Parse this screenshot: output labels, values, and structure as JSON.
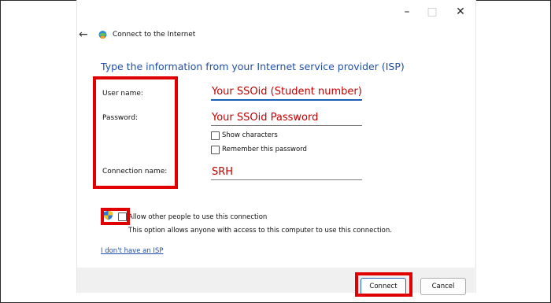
{
  "window": {
    "minimize_glyph": "–",
    "maximize_glyph": "□",
    "close_glyph": "✕",
    "back_glyph": "←",
    "title": "Connect to the Internet"
  },
  "form": {
    "heading": "Type the information from your Internet service provider (ISP)",
    "username_label": "User name:",
    "username_value": "Your SSOid (Student number)",
    "password_label": "Password:",
    "password_value": "Your SSOid Password",
    "show_characters_label": "Show characters",
    "remember_password_label": "Remember this password",
    "connection_name_label": "Connection name:",
    "connection_name_value": "SRH",
    "allow_others_label": "Allow other people to use this connection",
    "allow_others_note": "This option allows anyone with access to this computer to use this connection.",
    "no_isp_link": "I don't have an ISP"
  },
  "footer": {
    "connect_label": "Connect",
    "cancel_label": "Cancel"
  },
  "colors": {
    "accent": "#1f4fa8",
    "annotation_red": "#e00000",
    "value_red": "#c00000"
  },
  "icons": {
    "network": "network-globe-icon",
    "shield": "uac-shield-icon"
  }
}
